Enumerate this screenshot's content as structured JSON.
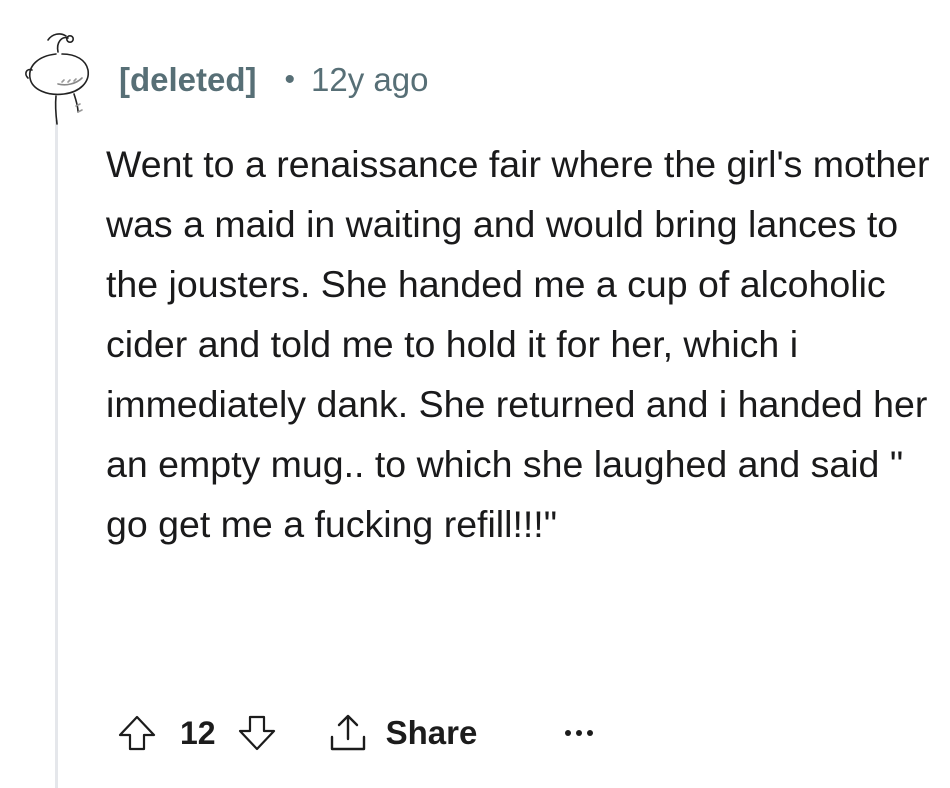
{
  "comment": {
    "author": "[deleted]",
    "separator": "•",
    "timestamp": "12y ago",
    "body": "Went to a renaissance fair where the girl's mother was a maid in waiting and would bring lances to the jousters. She handed me a cup of alcoholic cider and told me to hold it for her, which i immediately dank. She returned and i handed her an empty mug.. to which she laughed and said \" go get me a fucking refill!!!\"",
    "score": "12",
    "share_label": "Share"
  },
  "icons": {
    "avatar": "deleted-user-avatar-icon",
    "upvote": "upvote-arrow-icon",
    "downvote": "downvote-arrow-icon",
    "share": "share-upload-icon",
    "more": "more-options-icon"
  },
  "colors": {
    "meta_text": "#576f76",
    "body_text": "#1a1a1b",
    "thread_line": "#e5e7eb",
    "background": "#ffffff"
  }
}
